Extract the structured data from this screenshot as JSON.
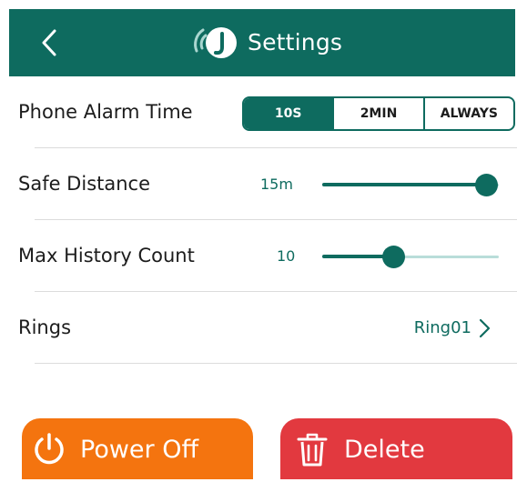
{
  "header": {
    "title": "Settings",
    "colors": {
      "header_bg": "#0e6b5f",
      "title_text": "#ffffff"
    }
  },
  "settings": {
    "phone_alarm_time": {
      "label": "Phone Alarm Time",
      "options": [
        "10S",
        "2MIN",
        "ALWAYS"
      ],
      "selected": "10S"
    },
    "safe_distance": {
      "label": "Safe Distance",
      "value": "15m",
      "fraction": 0.93
    },
    "max_history_count": {
      "label": "Max History Count",
      "value": "10",
      "fraction": 0.4
    },
    "rings": {
      "label": "Rings",
      "value": "Ring01"
    }
  },
  "buttons": {
    "power_off": {
      "label": "Power Off",
      "color": "#f4740f"
    },
    "delete": {
      "label": "Delete",
      "color": "#e2393f"
    }
  },
  "icons": {
    "back": "chevron-left-icon",
    "logo": "app-logo-icon",
    "chevron": "chevron-right-icon",
    "power": "power-icon",
    "trash": "trash-icon"
  }
}
